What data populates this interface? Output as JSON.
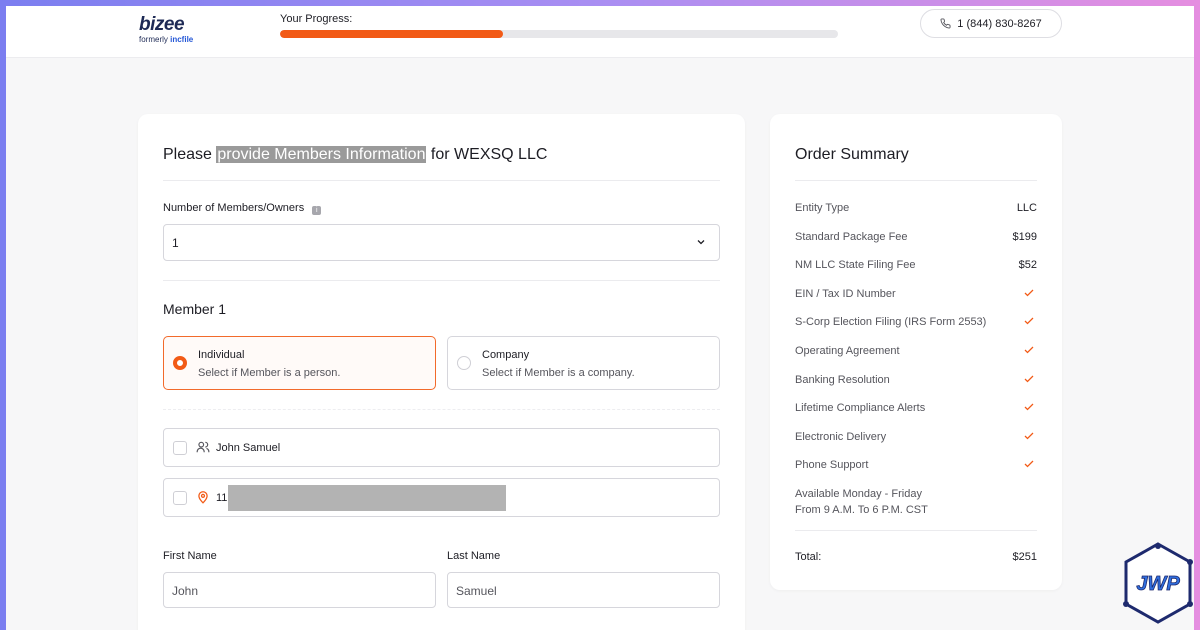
{
  "header": {
    "logo": "bizee",
    "logo_sub_prefix": "formerly",
    "logo_sub_brand": "incfile",
    "progress_label": "Your Progress:",
    "progress_fraction": 0.4,
    "phone": "1 (844) 830-8267"
  },
  "form": {
    "title_prefix": "Please",
    "title_highlight": "provide Members Information",
    "title_suffix": "for WEXSQ LLC",
    "members_label": "Number of Members/Owners",
    "members_value": "1",
    "member_title": "Member 1",
    "option_individual_title": "Individual",
    "option_individual_sub": "Select if Member is a person.",
    "option_company_title": "Company",
    "option_company_sub": "Select if Member is a company.",
    "saved_name": "John Samuel",
    "saved_address_prefix": "11",
    "first_name_label": "First Name",
    "first_name_value": "John",
    "last_name_label": "Last Name",
    "last_name_value": "Samuel"
  },
  "summary": {
    "title": "Order Summary",
    "rows": [
      {
        "label": "Entity Type",
        "value": "LLC"
      },
      {
        "label": "Standard Package Fee",
        "value": "$199"
      },
      {
        "label": "NM LLC State Filing Fee",
        "value": "$52"
      },
      {
        "label": "EIN / Tax ID Number",
        "value": ""
      },
      {
        "label": "S-Corp Election Filing (IRS Form 2553)",
        "value": ""
      },
      {
        "label": "Operating Agreement",
        "value": ""
      },
      {
        "label": "Banking Resolution",
        "value": ""
      },
      {
        "label": "Lifetime Compliance Alerts",
        "value": ""
      },
      {
        "label": "Electronic Delivery",
        "value": ""
      },
      {
        "label": "Phone Support",
        "value": ""
      }
    ],
    "hours_line1": "Available Monday - Friday",
    "hours_line2": "From 9 A.M. To 6 P.M. CST",
    "total_label": "Total:",
    "total_value": "$251"
  },
  "watermark_text": "JWP",
  "colors": {
    "accent": "#f25a16",
    "text": "#1d1d24",
    "border": "#d6d6dc"
  }
}
